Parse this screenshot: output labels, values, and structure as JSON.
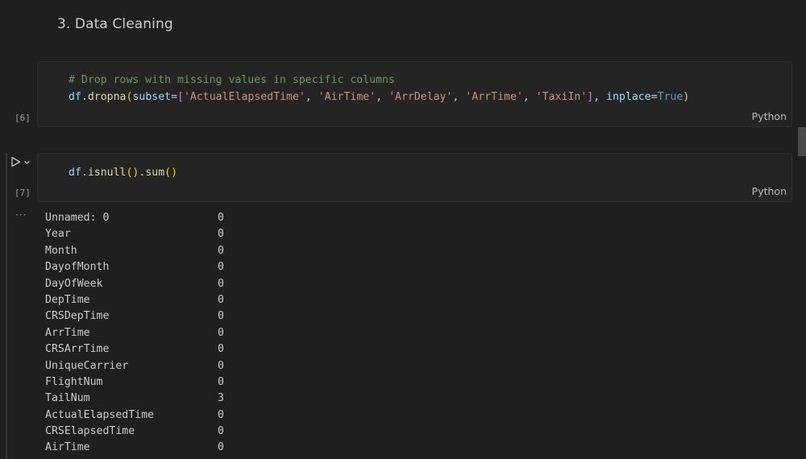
{
  "markdown": {
    "heading": "3. Data Cleaning"
  },
  "cells": [
    {
      "exec_count": "[6]",
      "language": "Python",
      "code": {
        "comment": "# Drop rows with missing values in specific columns",
        "var": "df",
        "func": "dropna",
        "param": "subset",
        "strings": [
          "'ActualElapsedTime'",
          "'AirTime'",
          "'ArrDelay'",
          "'ArrTime'",
          "'TaxiIn'"
        ],
        "param2": "inplace",
        "kw": "True"
      }
    },
    {
      "exec_count": "[7]",
      "language": "Python",
      "code": {
        "var": "df",
        "func1": "isnull",
        "func2": "sum"
      }
    }
  ],
  "output": {
    "ellipsis": "···",
    "rows": [
      {
        "name": "Unnamed: 0",
        "value": "0"
      },
      {
        "name": "Year",
        "value": "0"
      },
      {
        "name": "Month",
        "value": "0"
      },
      {
        "name": "DayofMonth",
        "value": "0"
      },
      {
        "name": "DayOfWeek",
        "value": "0"
      },
      {
        "name": "DepTime",
        "value": "0"
      },
      {
        "name": "CRSDepTime",
        "value": "0"
      },
      {
        "name": "ArrTime",
        "value": "0"
      },
      {
        "name": "CRSArrTime",
        "value": "0"
      },
      {
        "name": "UniqueCarrier",
        "value": "0"
      },
      {
        "name": "FlightNum",
        "value": "0"
      },
      {
        "name": "TailNum",
        "value": "3"
      },
      {
        "name": "ActualElapsedTime",
        "value": "0"
      },
      {
        "name": "CRSElapsedTime",
        "value": "0"
      },
      {
        "name": "AirTime",
        "value": "0"
      }
    ]
  },
  "icons": {
    "run": "play-icon",
    "run_menu": "chevron-down-icon"
  },
  "colors": {
    "background": "#1f1f1f",
    "cell_background": "#242424",
    "comment": "#6a9955",
    "string": "#ce9178",
    "keyword": "#569cd6",
    "function": "#dcdcaa",
    "variable": "#9cdcfe"
  }
}
